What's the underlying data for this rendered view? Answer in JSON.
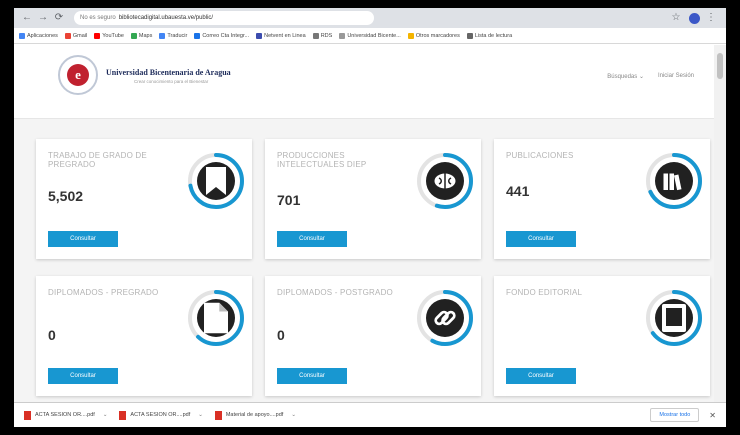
{
  "browser": {
    "address": {
      "warning": "No es seguro",
      "host": "bibliotecadigital.ubauesta.ve/public/"
    },
    "bookmarks": [
      {
        "label": "Aplicaciones",
        "color": "#4285f4"
      },
      {
        "label": "Gmail",
        "color": "#ea4335"
      },
      {
        "label": "YouTube",
        "color": "#ff0000"
      },
      {
        "label": "Maps",
        "color": "#34a853"
      },
      {
        "label": "Traducir",
        "color": "#4285f4"
      },
      {
        "label": "Correo Cta Integr...",
        "color": "#1a73e8"
      },
      {
        "label": "Netvent en Linea",
        "color": "#3c4cae"
      },
      {
        "label": "RDS",
        "color": "#777777"
      },
      {
        "label": "Universidad Bicente...",
        "color": "#999999"
      },
      {
        "label": "Otros marcadores",
        "color": "#f4b400"
      },
      {
        "label": "Lista de lectura",
        "color": "#666666"
      }
    ]
  },
  "header": {
    "logo_letter": "e",
    "university": "Universidad Bicentenaria de Aragua",
    "tagline": "Crear conocimiento para el Bienestar",
    "nav": [
      "Búsquedas ⌄",
      "Iniciar Sesión"
    ]
  },
  "cards": [
    {
      "title": "TRABAJO DE GRADO DE PREGRADO",
      "count": "5,502",
      "button": "Consultar",
      "icon": "bookmark-icon",
      "progress": 0.72
    },
    {
      "title": "PRODUCCIONES INTELECTUALES DIEP",
      "count": "701",
      "button": "Consultar",
      "icon": "brain-icon",
      "progress": 0.55
    },
    {
      "title": "PUBLICACIONES",
      "count": "441",
      "button": "Consultar",
      "icon": "books-icon",
      "progress": 0.68
    },
    {
      "title": "DIPLOMADOS - PREGRADO",
      "count": "0",
      "button": "Consultar",
      "icon": "document-icon",
      "progress": 0.62
    },
    {
      "title": "DIPLOMADOS - POSTGRADO",
      "count": "0",
      "button": "Consultar",
      "icon": "link-icon",
      "progress": 0.58
    },
    {
      "title": "FONDO EDITORIAL",
      "count": "",
      "button": "Consultar",
      "icon": "book-icon",
      "progress": 0.65
    }
  ],
  "downloads": {
    "items": [
      "ACTA SESION OR....pdf",
      "ACTA SESION OR....pdf",
      "Material de apoyo....pdf"
    ],
    "show_all": "Mostrar todo"
  },
  "colors": {
    "accent": "#1897d1",
    "icon_dark": "#212121"
  }
}
